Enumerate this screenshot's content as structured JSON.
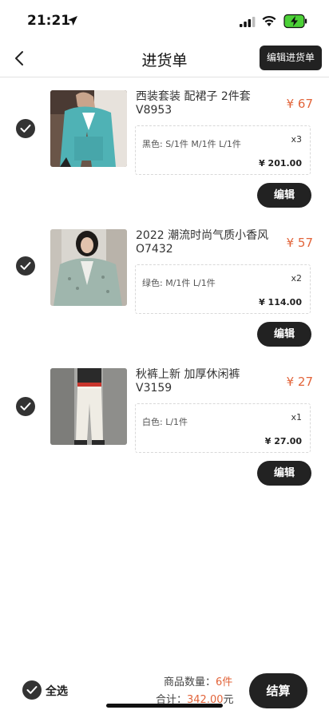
{
  "status": {
    "time": "21:21"
  },
  "nav": {
    "title": "进货单",
    "edit_list_label": "编辑进货单"
  },
  "items": [
    {
      "name": "西装套装 配裙子 2件套 V8953",
      "price": "¥ 67",
      "spec": "黑色: S/1件 M/1件 L/1件",
      "qty": "x3",
      "subtotal": "¥ 201.00",
      "edit_label": "编辑"
    },
    {
      "name": "2022 潮流时尚气质小香风 O7432",
      "price": "¥ 57",
      "spec": "绿色: M/1件 L/1件",
      "qty": "x2",
      "subtotal": "¥ 114.00",
      "edit_label": "编辑"
    },
    {
      "name": "秋裤上新 加厚休闲裤 V3159",
      "price": "¥ 27",
      "spec": "白色: L/1件",
      "qty": "x1",
      "subtotal": "¥ 27.00",
      "edit_label": "编辑"
    }
  ],
  "footer": {
    "select_all_label": "全选",
    "count_label": "商品数量：",
    "count_value": "6件",
    "total_label": "合计：",
    "total_value": "342.00",
    "total_unit": "元",
    "checkout_label": "结算"
  }
}
